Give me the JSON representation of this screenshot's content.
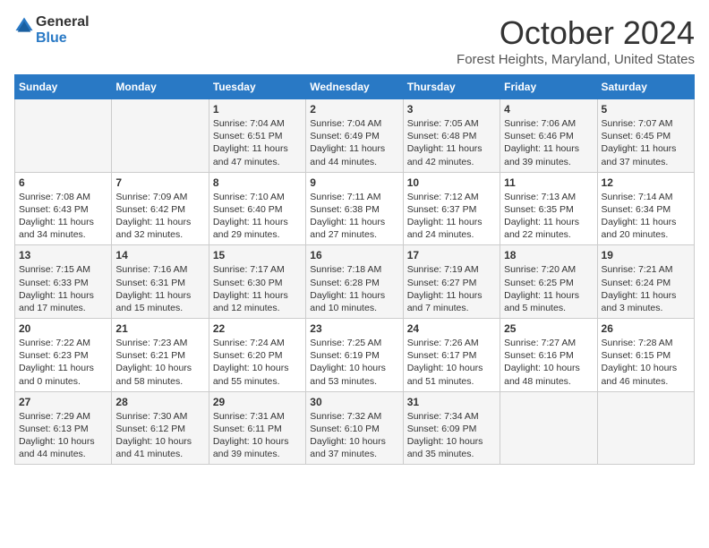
{
  "header": {
    "logo_line1": "General",
    "logo_line2": "Blue",
    "month": "October 2024",
    "location": "Forest Heights, Maryland, United States"
  },
  "weekdays": [
    "Sunday",
    "Monday",
    "Tuesday",
    "Wednesday",
    "Thursday",
    "Friday",
    "Saturday"
  ],
  "weeks": [
    [
      {
        "day": "",
        "sunrise": "",
        "sunset": "",
        "daylight": ""
      },
      {
        "day": "",
        "sunrise": "",
        "sunset": "",
        "daylight": ""
      },
      {
        "day": "1",
        "sunrise": "Sunrise: 7:04 AM",
        "sunset": "Sunset: 6:51 PM",
        "daylight": "Daylight: 11 hours and 47 minutes."
      },
      {
        "day": "2",
        "sunrise": "Sunrise: 7:04 AM",
        "sunset": "Sunset: 6:49 PM",
        "daylight": "Daylight: 11 hours and 44 minutes."
      },
      {
        "day": "3",
        "sunrise": "Sunrise: 7:05 AM",
        "sunset": "Sunset: 6:48 PM",
        "daylight": "Daylight: 11 hours and 42 minutes."
      },
      {
        "day": "4",
        "sunrise": "Sunrise: 7:06 AM",
        "sunset": "Sunset: 6:46 PM",
        "daylight": "Daylight: 11 hours and 39 minutes."
      },
      {
        "day": "5",
        "sunrise": "Sunrise: 7:07 AM",
        "sunset": "Sunset: 6:45 PM",
        "daylight": "Daylight: 11 hours and 37 minutes."
      }
    ],
    [
      {
        "day": "6",
        "sunrise": "Sunrise: 7:08 AM",
        "sunset": "Sunset: 6:43 PM",
        "daylight": "Daylight: 11 hours and 34 minutes."
      },
      {
        "day": "7",
        "sunrise": "Sunrise: 7:09 AM",
        "sunset": "Sunset: 6:42 PM",
        "daylight": "Daylight: 11 hours and 32 minutes."
      },
      {
        "day": "8",
        "sunrise": "Sunrise: 7:10 AM",
        "sunset": "Sunset: 6:40 PM",
        "daylight": "Daylight: 11 hours and 29 minutes."
      },
      {
        "day": "9",
        "sunrise": "Sunrise: 7:11 AM",
        "sunset": "Sunset: 6:38 PM",
        "daylight": "Daylight: 11 hours and 27 minutes."
      },
      {
        "day": "10",
        "sunrise": "Sunrise: 7:12 AM",
        "sunset": "Sunset: 6:37 PM",
        "daylight": "Daylight: 11 hours and 24 minutes."
      },
      {
        "day": "11",
        "sunrise": "Sunrise: 7:13 AM",
        "sunset": "Sunset: 6:35 PM",
        "daylight": "Daylight: 11 hours and 22 minutes."
      },
      {
        "day": "12",
        "sunrise": "Sunrise: 7:14 AM",
        "sunset": "Sunset: 6:34 PM",
        "daylight": "Daylight: 11 hours and 20 minutes."
      }
    ],
    [
      {
        "day": "13",
        "sunrise": "Sunrise: 7:15 AM",
        "sunset": "Sunset: 6:33 PM",
        "daylight": "Daylight: 11 hours and 17 minutes."
      },
      {
        "day": "14",
        "sunrise": "Sunrise: 7:16 AM",
        "sunset": "Sunset: 6:31 PM",
        "daylight": "Daylight: 11 hours and 15 minutes."
      },
      {
        "day": "15",
        "sunrise": "Sunrise: 7:17 AM",
        "sunset": "Sunset: 6:30 PM",
        "daylight": "Daylight: 11 hours and 12 minutes."
      },
      {
        "day": "16",
        "sunrise": "Sunrise: 7:18 AM",
        "sunset": "Sunset: 6:28 PM",
        "daylight": "Daylight: 11 hours and 10 minutes."
      },
      {
        "day": "17",
        "sunrise": "Sunrise: 7:19 AM",
        "sunset": "Sunset: 6:27 PM",
        "daylight": "Daylight: 11 hours and 7 minutes."
      },
      {
        "day": "18",
        "sunrise": "Sunrise: 7:20 AM",
        "sunset": "Sunset: 6:25 PM",
        "daylight": "Daylight: 11 hours and 5 minutes."
      },
      {
        "day": "19",
        "sunrise": "Sunrise: 7:21 AM",
        "sunset": "Sunset: 6:24 PM",
        "daylight": "Daylight: 11 hours and 3 minutes."
      }
    ],
    [
      {
        "day": "20",
        "sunrise": "Sunrise: 7:22 AM",
        "sunset": "Sunset: 6:23 PM",
        "daylight": "Daylight: 11 hours and 0 minutes."
      },
      {
        "day": "21",
        "sunrise": "Sunrise: 7:23 AM",
        "sunset": "Sunset: 6:21 PM",
        "daylight": "Daylight: 10 hours and 58 minutes."
      },
      {
        "day": "22",
        "sunrise": "Sunrise: 7:24 AM",
        "sunset": "Sunset: 6:20 PM",
        "daylight": "Daylight: 10 hours and 55 minutes."
      },
      {
        "day": "23",
        "sunrise": "Sunrise: 7:25 AM",
        "sunset": "Sunset: 6:19 PM",
        "daylight": "Daylight: 10 hours and 53 minutes."
      },
      {
        "day": "24",
        "sunrise": "Sunrise: 7:26 AM",
        "sunset": "Sunset: 6:17 PM",
        "daylight": "Daylight: 10 hours and 51 minutes."
      },
      {
        "day": "25",
        "sunrise": "Sunrise: 7:27 AM",
        "sunset": "Sunset: 6:16 PM",
        "daylight": "Daylight: 10 hours and 48 minutes."
      },
      {
        "day": "26",
        "sunrise": "Sunrise: 7:28 AM",
        "sunset": "Sunset: 6:15 PM",
        "daylight": "Daylight: 10 hours and 46 minutes."
      }
    ],
    [
      {
        "day": "27",
        "sunrise": "Sunrise: 7:29 AM",
        "sunset": "Sunset: 6:13 PM",
        "daylight": "Daylight: 10 hours and 44 minutes."
      },
      {
        "day": "28",
        "sunrise": "Sunrise: 7:30 AM",
        "sunset": "Sunset: 6:12 PM",
        "daylight": "Daylight: 10 hours and 41 minutes."
      },
      {
        "day": "29",
        "sunrise": "Sunrise: 7:31 AM",
        "sunset": "Sunset: 6:11 PM",
        "daylight": "Daylight: 10 hours and 39 minutes."
      },
      {
        "day": "30",
        "sunrise": "Sunrise: 7:32 AM",
        "sunset": "Sunset: 6:10 PM",
        "daylight": "Daylight: 10 hours and 37 minutes."
      },
      {
        "day": "31",
        "sunrise": "Sunrise: 7:34 AM",
        "sunset": "Sunset: 6:09 PM",
        "daylight": "Daylight: 10 hours and 35 minutes."
      },
      {
        "day": "",
        "sunrise": "",
        "sunset": "",
        "daylight": ""
      },
      {
        "day": "",
        "sunrise": "",
        "sunset": "",
        "daylight": ""
      }
    ]
  ]
}
